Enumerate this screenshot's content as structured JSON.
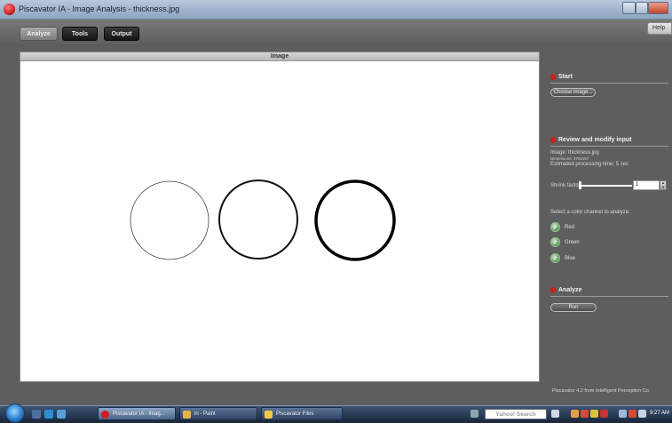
{
  "window": {
    "title": "Piscavator IA - Image Analysis - thickness.jpg"
  },
  "toolbar": {
    "tabs": [
      {
        "label": "Analyze",
        "active": true
      },
      {
        "label": "Tools",
        "active": false
      },
      {
        "label": "Output",
        "active": false
      }
    ],
    "help_label": "Help"
  },
  "image_panel": {
    "header": "Image",
    "circles": [
      {
        "thickness": "thin"
      },
      {
        "thickness": "medium"
      },
      {
        "thickness": "thick"
      }
    ]
  },
  "side": {
    "start": {
      "title": "Start",
      "choose_button": "Choose image..."
    },
    "review": {
      "title": "Review and modify input",
      "image_label": "Image: thickness.jpg",
      "dimensions_label": "Dimensions: 370x157",
      "processing_label": "Estimated processing time: 5 sec",
      "shrink_label": "Shrink factor:",
      "shrink_value": "1",
      "channel_prompt": "Select a color channel to analyze:",
      "channels": [
        {
          "label": "Red",
          "checked": true
        },
        {
          "label": "Green",
          "checked": true
        },
        {
          "label": "Blue",
          "checked": true
        }
      ]
    },
    "analyze": {
      "title": "Analyze",
      "run_button": "Run"
    },
    "footer": "Piscavator 4.2 from Intelligent Perception Co."
  },
  "taskbar": {
    "tasks": [
      {
        "label": "Piscavator IA - Imag...",
        "active": true
      },
      {
        "label": "in - Paint",
        "active": false
      },
      {
        "label": "Piscavator Files",
        "active": false
      }
    ],
    "search_placeholder": "Yahoo! Search",
    "clock": "9:27 AM"
  },
  "colors": {
    "accent": "#d41c1c",
    "panel_bg": "#5e5e5e",
    "radio_green": "#6aa366"
  }
}
